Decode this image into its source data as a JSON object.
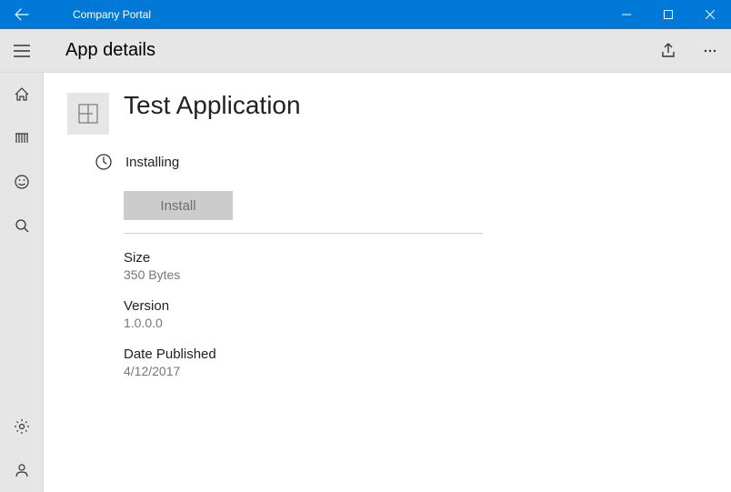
{
  "window": {
    "title": "Company Portal"
  },
  "header": {
    "heading": "App details"
  },
  "app": {
    "name": "Test Application",
    "status": "Installing",
    "install_label": "Install",
    "fields": {
      "size": {
        "label": "Size",
        "value": "350 Bytes"
      },
      "version": {
        "label": "Version",
        "value": "1.0.0.0"
      },
      "date": {
        "label": "Date Published",
        "value": "4/12/2017"
      }
    }
  }
}
